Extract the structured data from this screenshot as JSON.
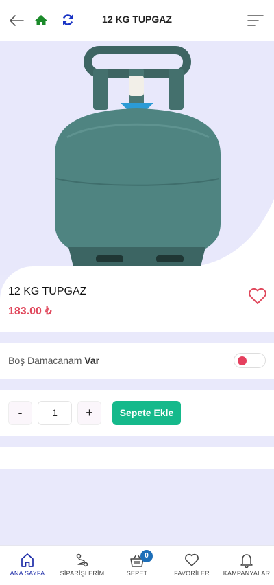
{
  "header": {
    "title": "12 KG TUPGAZ",
    "icons": [
      "arrow-left-icon",
      "home-icon",
      "refresh-icon",
      "menu-icon"
    ]
  },
  "product": {
    "name": "12 KG TUPGAZ",
    "price": "183.00 ₺",
    "image": "gas-cylinder-image"
  },
  "empty_container": {
    "label_prefix": "Boş Damacanam",
    "label_value": "Var"
  },
  "cart": {
    "minus_label": "-",
    "quantity": "1",
    "plus_label": "+",
    "add_label": "Sepete Ekle"
  },
  "bottom_nav": {
    "home": "ANA SAYFA",
    "orders": "SİPARİŞLERİM",
    "basket": "SEPET",
    "basket_count": "0",
    "favorites": "FAVORİLER",
    "campaigns": "KAMPANYALAR"
  },
  "colors": {
    "accent": "#1d2ca8",
    "price": "#e0485c",
    "add_button": "#15b98b",
    "background": "#e9e9fb"
  }
}
